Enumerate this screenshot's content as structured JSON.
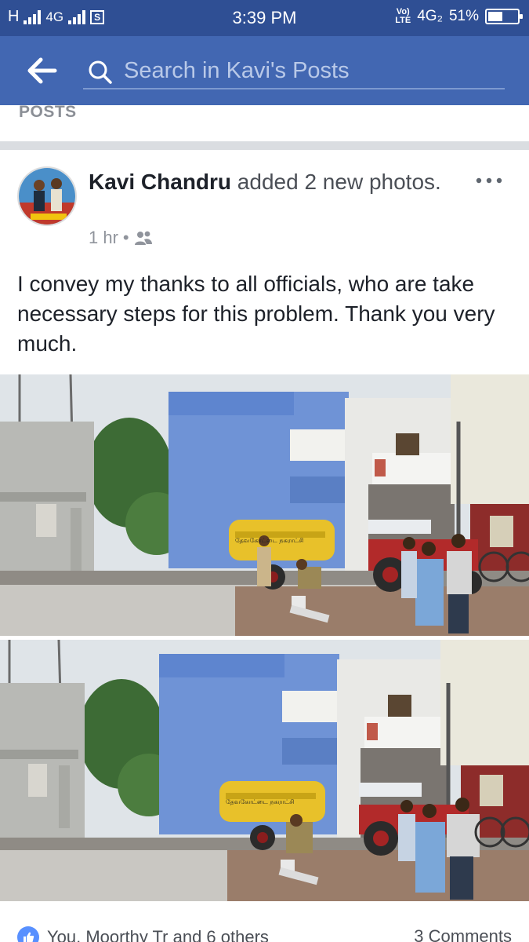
{
  "status_bar": {
    "network_left": "H",
    "network_type": "4G",
    "time": "3:39 PM",
    "volte_top": "Vo)",
    "volte_bottom": "LTE",
    "network_right": "4G₂",
    "battery": "51%",
    "battery_level": 0.51
  },
  "app_bar": {
    "search_placeholder": "Search in Kavi's Posts",
    "back_icon": "back-arrow-icon",
    "search_icon": "search-icon"
  },
  "section_label": "POSTS",
  "post": {
    "author": "Kavi Chandru",
    "action": " added 2 new photos.",
    "time": "1 hr",
    "separator": "•",
    "privacy_icon": "friends-icon",
    "text": "I convey my thanks to all officials, who are take necessary steps for this problem. Thank you very much.",
    "photos": [
      {
        "tanker_text": "தேவகோட்டை நகராட்சி"
      },
      {
        "tanker_text": "தேவகோட்டை நகராட்சி"
      }
    ],
    "reactions": "You, Moorthy Tr and 6 others",
    "comments": "3 Comments"
  },
  "colors": {
    "status_bar": "#2f4f94",
    "app_bar": "#4267b2",
    "like_blue": "#5890ff"
  }
}
